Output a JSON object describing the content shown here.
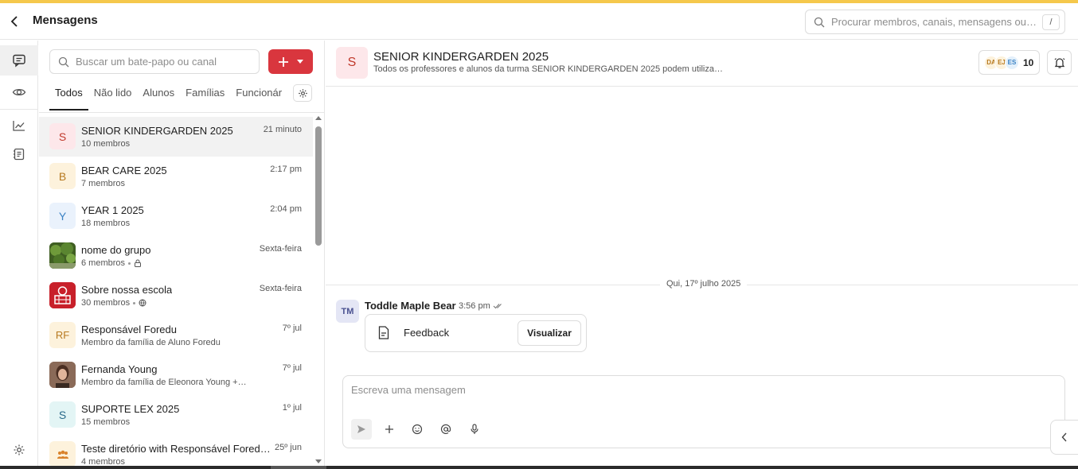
{
  "header": {
    "title": "Mensagens",
    "search_placeholder": "Procurar membros, canais, mensagens ou…",
    "search_shortcut": "/"
  },
  "rail": {
    "items": [
      "chat-icon",
      "eye-icon",
      "trend-chart-icon",
      "notes-icon",
      "settings-icon"
    ]
  },
  "chat_list": {
    "search_placeholder": "Buscar um bate-papo ou canal",
    "tabs": [
      "Todos",
      "Não lido",
      "Alunos",
      "Famílias",
      "Funcionár"
    ],
    "active_tab": "Todos",
    "items": [
      {
        "initials": "S",
        "name": "SENIOR KINDERGARDEN 2025",
        "subtitle": "10 membros",
        "time": "21 minuto",
        "color": "#c0392b",
        "bg": "#fde7ea",
        "selected": true
      },
      {
        "initials": "B",
        "name": "BEAR CARE 2025",
        "subtitle": "7 membros",
        "time": "2:17 pm",
        "color": "#b7791f",
        "bg": "#fdf2dc"
      },
      {
        "initials": "Y",
        "name": "YEAR 1 2025",
        "subtitle": "18 membros",
        "time": "2:04 pm",
        "color": "#3b82c4",
        "bg": "#eaf2fc"
      },
      {
        "initials": "",
        "name": "nome do grupo",
        "subtitle": "6 membros",
        "time": "Sexta-feira",
        "icon": "lock-icon",
        "image": "forest"
      },
      {
        "initials": "",
        "name": "Sobre nossa escola",
        "subtitle": "30 membros",
        "time": "Sexta-feira",
        "icon": "globe-icon",
        "image": "school"
      },
      {
        "initials": "RF",
        "name": "Responsável Foredu",
        "subtitle": "Membro da família de Aluno Foredu",
        "time": "7º jul",
        "color": "#b7791f",
        "bg": "#fdf2dc"
      },
      {
        "initials": "",
        "name": "Fernanda Young",
        "subtitle": "Membro da família de Eleonora Young +…",
        "time": "7º jul",
        "image": "person"
      },
      {
        "initials": "S",
        "name": "SUPORTE LEX 2025",
        "subtitle": "15 membros",
        "time": "1º jul",
        "color": "#2a8a8a",
        "bg": "#e3f5f5"
      },
      {
        "initials": "",
        "name": "Teste diretório with Responsável Fored…",
        "subtitle": "4 membros",
        "time": "25º jun",
        "image": "group"
      }
    ]
  },
  "conversation": {
    "initials": "S",
    "title": "SENIOR KINDERGARDEN 2025",
    "description": "Todos os professores e alunos da turma SENIOR KINDERGARDEN 2025 podem utiliza…",
    "member_avatars": [
      {
        "label": "DA",
        "bg": "#fdf2dc",
        "color": "#b7791f"
      },
      {
        "label": "EJ",
        "bg": "#fdf2dc",
        "color": "#b7791f"
      },
      {
        "label": "ES",
        "bg": "#e3f0fb",
        "color": "#3b82c4"
      }
    ],
    "member_count": "10",
    "date_divider": "Qui, 17º julho 2025",
    "message": {
      "avatar": "TM",
      "sender": "Toddle Maple Bear",
      "time": "3:56 pm",
      "attachment_name": "Feedback",
      "attachment_action": "Visualizar"
    },
    "composer_placeholder": "Escreva uma mensagem"
  }
}
